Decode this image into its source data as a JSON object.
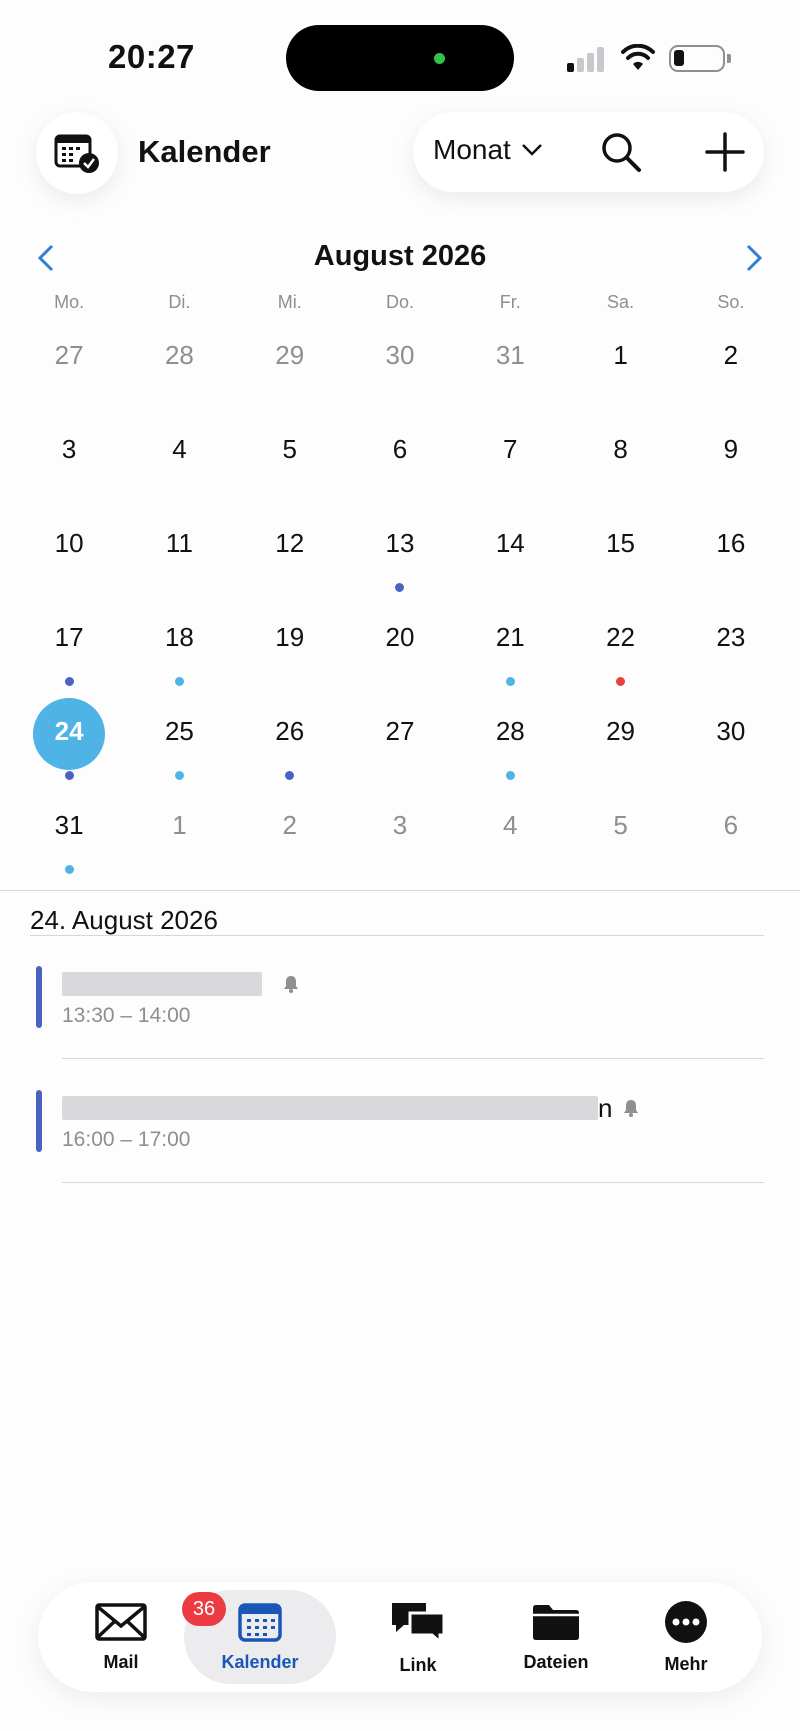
{
  "status_bar": {
    "time": "20:27"
  },
  "header": {
    "title": "Kalender",
    "view_label": "Monat",
    "icons": {
      "app": "calendar-check-icon",
      "search": "search-icon",
      "add": "plus-icon",
      "view": "chevron-down-icon"
    }
  },
  "calendar": {
    "month_title": "August 2026",
    "weekdays": [
      "Mo.",
      "Di.",
      "Mi.",
      "Do.",
      "Fr.",
      "Sa.",
      "So."
    ],
    "weeks": [
      [
        {
          "d": "27",
          "m": true
        },
        {
          "d": "28",
          "m": true
        },
        {
          "d": "29",
          "m": true
        },
        {
          "d": "30",
          "m": true
        },
        {
          "d": "31",
          "m": true
        },
        {
          "d": "1"
        },
        {
          "d": "2"
        }
      ],
      [
        {
          "d": "3"
        },
        {
          "d": "4"
        },
        {
          "d": "5"
        },
        {
          "d": "6"
        },
        {
          "d": "7"
        },
        {
          "d": "8"
        },
        {
          "d": "9"
        }
      ],
      [
        {
          "d": "10"
        },
        {
          "d": "11"
        },
        {
          "d": "12"
        },
        {
          "d": "13",
          "dot": "#4a63c0"
        },
        {
          "d": "14"
        },
        {
          "d": "15"
        },
        {
          "d": "16"
        }
      ],
      [
        {
          "d": "17",
          "dot": "#4a63c0"
        },
        {
          "d": "18",
          "dot": "#4fb3e6"
        },
        {
          "d": "19"
        },
        {
          "d": "20"
        },
        {
          "d": "21",
          "dot": "#4fb3e6"
        },
        {
          "d": "22",
          "dot": "#e8423f"
        },
        {
          "d": "23"
        }
      ],
      [
        {
          "d": "24",
          "today": true,
          "dot": "#4a63c0"
        },
        {
          "d": "25",
          "dot": "#4fb3e6"
        },
        {
          "d": "26",
          "dot": "#4a63c0"
        },
        {
          "d": "27"
        },
        {
          "d": "28",
          "dot": "#4fb3e6"
        },
        {
          "d": "29"
        },
        {
          "d": "30"
        }
      ],
      [
        {
          "d": "31",
          "dot": "#4fb3e6"
        },
        {
          "d": "1",
          "m": true
        },
        {
          "d": "2",
          "m": true
        },
        {
          "d": "3",
          "m": true
        },
        {
          "d": "4",
          "m": true
        },
        {
          "d": "5",
          "m": true
        },
        {
          "d": "6",
          "m": true
        }
      ]
    ],
    "today_color": "#4fb3e6"
  },
  "agenda": {
    "date": "24. August 2026",
    "events": [
      {
        "title_visible_end": "",
        "time": "13:30 – 14:00",
        "color": "#4a63c0",
        "redacted": true
      },
      {
        "title_visible_end": "n",
        "time": "16:00 – 17:00",
        "color": "#4a63c0",
        "redacted": true
      }
    ]
  },
  "tabbar": {
    "tabs": [
      {
        "label": "Mail",
        "icon": "mail-icon",
        "badge": "36"
      },
      {
        "label": "Kalender",
        "icon": "calendar-icon",
        "active": true
      },
      {
        "label": "Link",
        "icon": "chat-bubbles-icon"
      },
      {
        "label": "Dateien",
        "icon": "folder-icon"
      },
      {
        "label": "Mehr",
        "icon": "more-icon"
      }
    ],
    "accent": "#1a56b8"
  }
}
